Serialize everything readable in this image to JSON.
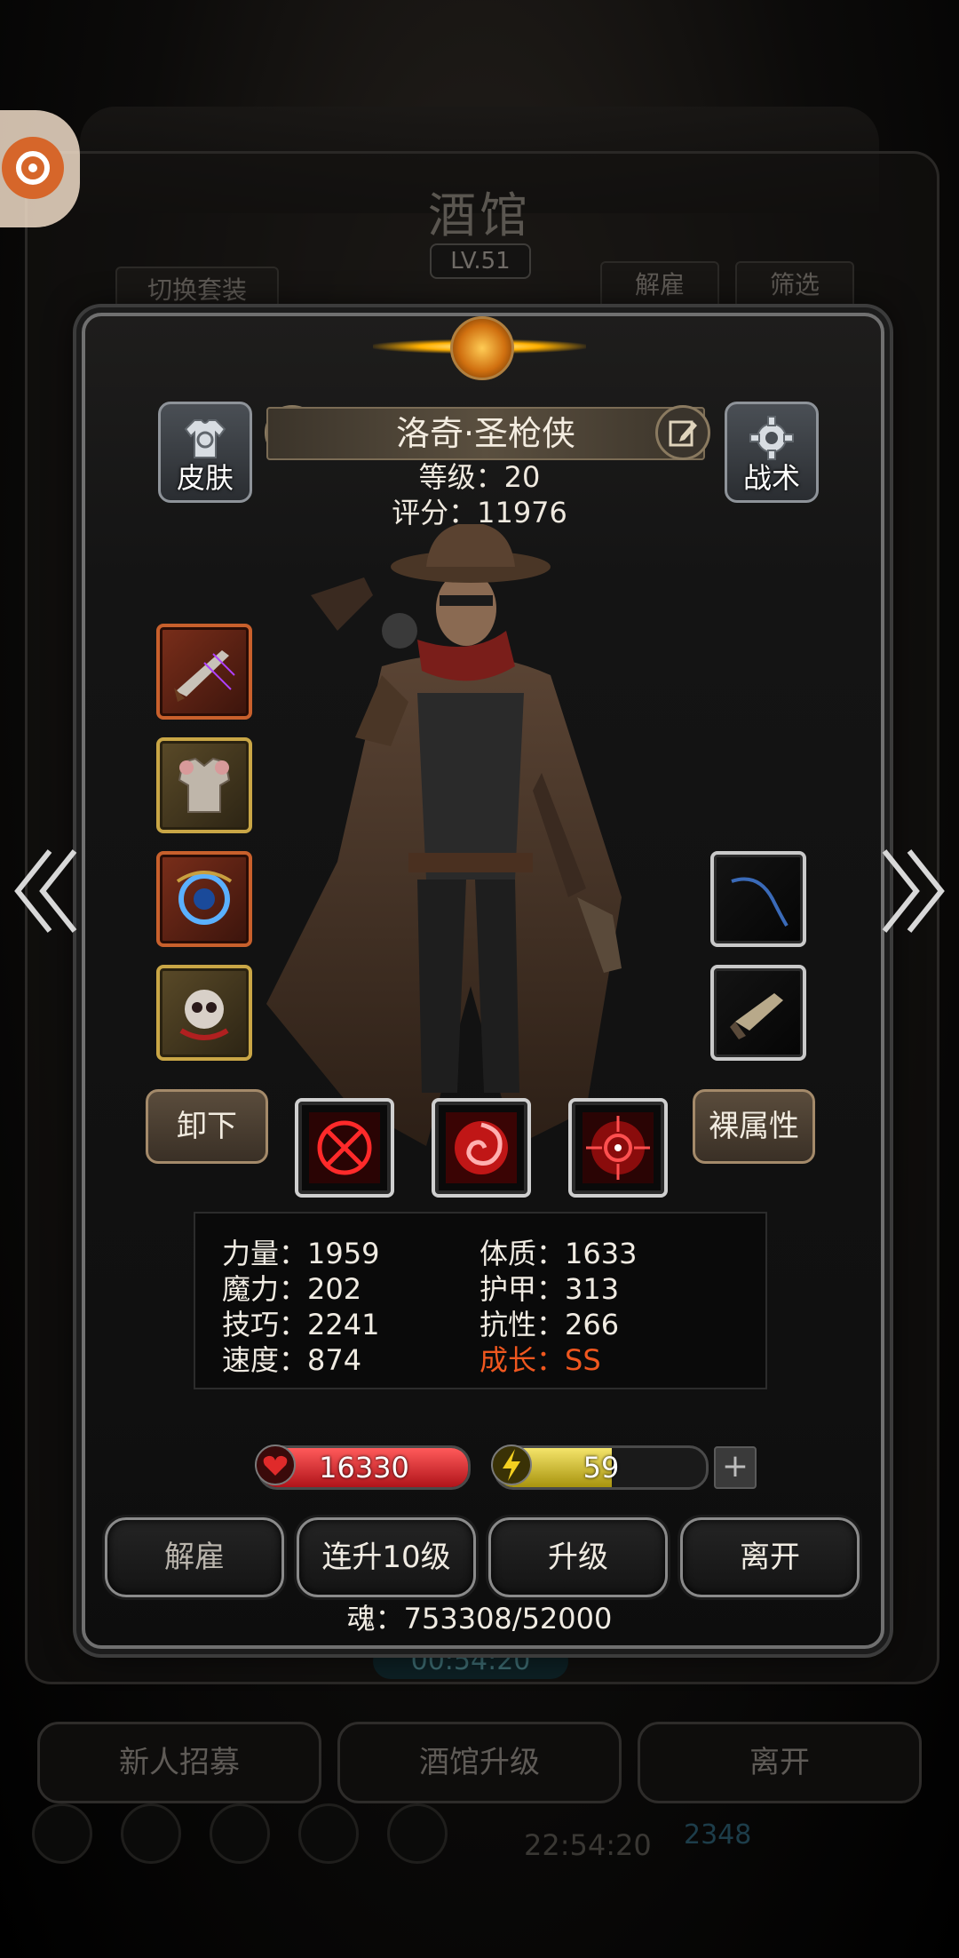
{
  "background": {
    "title": "酒馆",
    "level": "LV.51",
    "switch_outfit": "切换套装",
    "dismiss": "解雇",
    "filter": "筛选",
    "timer": "00:54:20",
    "bottom_buttons": [
      "新人招募",
      "酒馆升级",
      "离开"
    ],
    "clock": "22:54:20",
    "coins": "2348"
  },
  "hero": {
    "name": "洛奇·圣枪侠",
    "level_text": "等级：20",
    "score_text": "评分：11976"
  },
  "side_buttons": {
    "skin": "皮肤",
    "tactics": "战术"
  },
  "actions": {
    "unequip": "卸下",
    "naked_attr": "裸属性"
  },
  "stats": {
    "strength": "力量：1959",
    "magic": "魔力：202",
    "skill": "技巧：2241",
    "speed": "速度：874",
    "constitution": "体质：1633",
    "armor": "护甲：313",
    "resistance": "抗性：266",
    "growth": "成长：SS"
  },
  "bars": {
    "hp": "16330",
    "energy": "59",
    "energy_fill": 0.55,
    "plus": "+"
  },
  "buttons": {
    "dismiss": "解雇",
    "level_up_10": "连升10级",
    "level_up": "升级",
    "leave": "离开"
  },
  "soul_text": "魂：753308/52000",
  "colors": {
    "growth": "#f0571f",
    "hp_fill": "#d42228",
    "energy_fill": "#d9c41c"
  }
}
